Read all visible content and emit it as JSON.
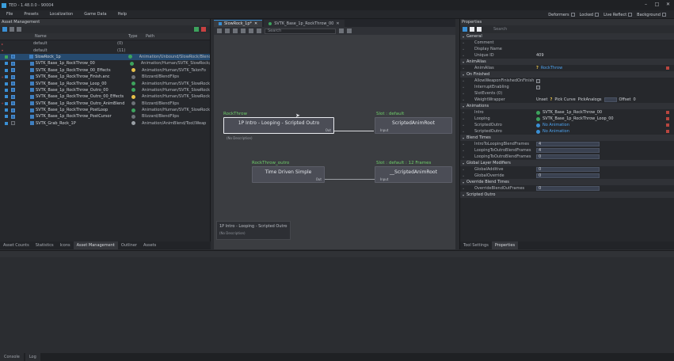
{
  "window": {
    "title": "TED - 1.48.0.0 - 90004"
  },
  "menu": [
    "File",
    "Presets",
    "Localization",
    "Game Data",
    "Help"
  ],
  "toolbar_right": [
    "Deformers",
    "Locked",
    "Live Reflect",
    "Background"
  ],
  "asset_panel": {
    "title": "Asset Management",
    "columns": {
      "name": "Name",
      "type": "Type",
      "path": "Path"
    },
    "groups": [
      {
        "name": "default",
        "count": "(0)"
      },
      {
        "name": "default",
        "count": "(11)"
      }
    ],
    "rows": [
      {
        "name": "SlowRock_1p",
        "path": "Animation/Unbound/SlowRock/Blend",
        "selected": true
      },
      {
        "name": "SVTK_Base_1p_RockThrow_00",
        "path": "Animation/Human/SVTK_SlowRock/",
        "selected": false
      },
      {
        "name": "SVTK_Base_1p_RockThrow_00_Effects",
        "path": "Animation/Human/SVTK_TalonFo",
        "selected": false
      },
      {
        "name": "SVTK_Base_1p_RockThrow_Finish.anc",
        "path": "Blizzard/BlendFlips",
        "selected": false
      },
      {
        "name": "SVTK_Base_1p_RockThrow_Loop_00",
        "path": "Animation/Human/SVTK_SlowRock",
        "selected": false
      },
      {
        "name": "SVTK_Base_1p_RockThrow_Outro_00",
        "path": "Animation/Human/SVTK_SlowRock",
        "selected": false
      },
      {
        "name": "SVTK_Base_1p_RockThrow_Outro_00_Effects",
        "path": "Animation/Human/SVTK_SlowRock",
        "selected": false
      },
      {
        "name": "SVTK_Base_1p_RockThrow_Outro_AnimBlends",
        "path": "Blizzard/BlendFlips",
        "selected": false
      },
      {
        "name": "SVTK_Base_1p_RockThrow_PostLoop",
        "path": "Animation/Human/SVTK_SlowRock",
        "selected": false
      },
      {
        "name": "SVTK_Base_1p_RockThrow_PostCursor",
        "path": "Blizzard/BlendFlips",
        "selected": false
      },
      {
        "name": "SVTK_Grab_Rock_1P",
        "path": "Animation/AnimBlend/Tool/Weap",
        "selected": false
      }
    ],
    "tabs": [
      "Asset Counts",
      "Statistics",
      "Icons",
      "Asset Management",
      "Outliner",
      "Assets"
    ]
  },
  "graph": {
    "tabs": [
      "SlowRock_1p*",
      "SVTK_Base_1p_RockThrow_00"
    ],
    "search_placeholder": "Search",
    "nodes": [
      {
        "label": "RockThrow",
        "title": "1P Intro - Looping - Scripted Outro",
        "out_pin": "Out",
        "sub": "(No Description)"
      },
      {
        "label": "Slot : default",
        "title": "ScriptedAnimRoot",
        "in_pin": "Input"
      },
      {
        "label": "RockThrow_outro",
        "title": "Time Driven Simple",
        "out_pin": "Out"
      },
      {
        "label": "Slot : default : 12 Frames",
        "title": "__ScriptedAnimRoot",
        "in_pin": "Input"
      }
    ],
    "tooltip": {
      "title": "1P Intro - Looping - Scripted Outro",
      "sub": "(No Description)"
    }
  },
  "properties": {
    "title": "Properties",
    "search_placeholder": "Search",
    "sections": [
      {
        "cat": "General",
        "rows": [
          {
            "label": "Comment",
            "value": ""
          },
          {
            "label": "Display Name",
            "value": ""
          },
          {
            "label": "Unique ID",
            "value": "409"
          }
        ]
      },
      {
        "cat": "AnimAlias",
        "rows": [
          {
            "label": "AnimAlias",
            "value": "RockThrow",
            "kind": "q"
          }
        ]
      },
      {
        "cat": "On Finished",
        "rows": [
          {
            "label": "AllowWeaponFinishedOnFinish",
            "value": "",
            "kind": "chk"
          },
          {
            "label": "InterruptEnabling",
            "value": "",
            "kind": "chk"
          },
          {
            "label": "SlotEvents (0)",
            "value": "",
            "kind": ""
          },
          {
            "label": "WeightWrapper",
            "value": "Unset",
            "kind": "ww"
          }
        ]
      },
      {
        "cat": "Animations",
        "rows": [
          {
            "label": "Intro",
            "value": "SVTK_Base_1p_RockThrow_00",
            "kind": "ok"
          },
          {
            "label": "Looping",
            "value": "SVTK_Base_1p_RockThrow_Loop_00",
            "kind": "ok"
          },
          {
            "label": "ScriptedOutro",
            "value": "No Animation",
            "kind": "lnk"
          },
          {
            "label": "ScriptedOutro",
            "value": "No Animation",
            "kind": "lnk"
          }
        ]
      },
      {
        "cat": "Blend Times",
        "rows": [
          {
            "label": "IntroToLoopingBlendFrames",
            "value": "4",
            "kind": "bar"
          },
          {
            "label": "LoopingToOutroBlendFrames",
            "value": "4",
            "kind": "bar"
          },
          {
            "label": "LoopingToOutroBlendFrames",
            "value": "0",
            "kind": "bar"
          }
        ]
      },
      {
        "cat": "Global Layer Modifiers",
        "rows": [
          {
            "label": "GlobalAdditive",
            "value": "0",
            "kind": "bar"
          },
          {
            "label": "GlobalOverride",
            "value": "0",
            "kind": "bar"
          }
        ]
      },
      {
        "cat": "Override Blend Times",
        "rows": [
          {
            "label": "OverrideBlendOutFrames",
            "value": "0",
            "kind": "bar"
          }
        ]
      },
      {
        "cat": "Scripted Outro",
        "rows": []
      }
    ],
    "weight_fields": [
      "Pick Curve",
      "PickAnalogs",
      "Offset",
      "0"
    ],
    "tabs": [
      "Tool Settings",
      "Properties"
    ]
  },
  "status": [
    "Console",
    "Log"
  ]
}
